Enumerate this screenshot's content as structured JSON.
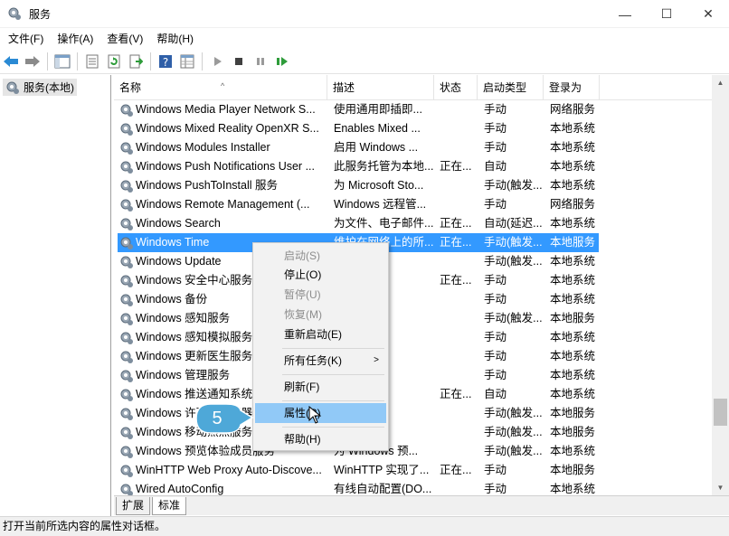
{
  "window": {
    "title": "服务",
    "minimize": "—",
    "maximize": "☐",
    "close": "✕"
  },
  "menu": [
    "文件(F)",
    "操作(A)",
    "查看(V)",
    "帮助(H)"
  ],
  "tree": {
    "root": "服务(本地)"
  },
  "columns": {
    "name": "名称",
    "desc": "描述",
    "status": "状态",
    "start": "启动类型",
    "logon": "登录为"
  },
  "rows": [
    {
      "name": "Windows Media Player Network S...",
      "desc": "使用通用即插即...",
      "status": "",
      "start": "手动",
      "logon": "网络服务"
    },
    {
      "name": "Windows Mixed Reality OpenXR S...",
      "desc": "Enables Mixed ...",
      "status": "",
      "start": "手动",
      "logon": "本地系统"
    },
    {
      "name": "Windows Modules Installer",
      "desc": "启用 Windows ...",
      "status": "",
      "start": "手动",
      "logon": "本地系统"
    },
    {
      "name": "Windows Push Notifications User ...",
      "desc": "此服务托管为本地...",
      "status": "正在...",
      "start": "自动",
      "logon": "本地系统"
    },
    {
      "name": "Windows PushToInstall 服务",
      "desc": "为 Microsoft Sto...",
      "status": "",
      "start": "手动(触发...",
      "logon": "本地系统"
    },
    {
      "name": "Windows Remote Management (...",
      "desc": "Windows 远程管...",
      "status": "",
      "start": "手动",
      "logon": "网络服务"
    },
    {
      "name": "Windows Search",
      "desc": "为文件、电子邮件...",
      "status": "正在...",
      "start": "自动(延迟...",
      "logon": "本地系统"
    },
    {
      "name": "Windows Time",
      "desc": "维护在网络上的所...",
      "status": "正在...",
      "start": "手动(触发...",
      "logon": "本地服务"
    },
    {
      "name": "Windows Update",
      "desc": "下载和...",
      "status": "",
      "start": "手动(触发...",
      "logon": "本地系统"
    },
    {
      "name": "Windows 安全中心服务",
      "desc": "安全中...",
      "status": "正在...",
      "start": "手动",
      "logon": "本地系统"
    },
    {
      "name": "Windows 备份",
      "desc": "ows ...",
      "status": "",
      "start": "手动",
      "logon": "本地系统"
    },
    {
      "name": "Windows 感知服务",
      "desc": "知、空...",
      "status": "",
      "start": "手动(触发...",
      "logon": "本地服务"
    },
    {
      "name": "Windows 感知模拟服务",
      "desc": "和模拟...",
      "status": "",
      "start": "手动",
      "logon": "本地系统"
    },
    {
      "name": "Windows 更新医生服务",
      "desc": "ows ...",
      "status": "",
      "start": "手动",
      "logon": "本地系统"
    },
    {
      "name": "Windows 管理服务",
      "desc": "配和注...",
      "status": "",
      "start": "手动",
      "logon": "本地系统"
    },
    {
      "name": "Windows 推送通知系统",
      "desc": "括 0 ...",
      "status": "正在...",
      "start": "自动",
      "logon": "本地系统"
    },
    {
      "name": "Windows 许可证管理器服务",
      "desc": "ft Sto...",
      "status": "",
      "start": "手动(触发...",
      "logon": "本地服务"
    },
    {
      "name": "Windows 移动热点服务",
      "desc": "备共共...",
      "status": "",
      "start": "手动(触发...",
      "logon": "本地服务"
    },
    {
      "name": "Windows 预览体验成员服务",
      "desc": "为 Windows 预...",
      "status": "",
      "start": "手动(触发...",
      "logon": "本地系统"
    },
    {
      "name": "WinHTTP Web Proxy Auto-Discove...",
      "desc": "WinHTTP 实现了...",
      "status": "正在...",
      "start": "手动",
      "logon": "本地服务"
    },
    {
      "name": "Wired AutoConfig",
      "desc": "有线自动配置(DO...",
      "status": "",
      "start": "手动",
      "logon": "本地系统"
    }
  ],
  "selected_row": 7,
  "context_menu": {
    "start": "启动(S)",
    "stop": "停止(O)",
    "pause": "暂停(U)",
    "resume": "恢复(M)",
    "restart": "重新启动(E)",
    "all_tasks": "所有任务(K)",
    "refresh": "刷新(F)",
    "properties": "属性(R)",
    "help": "帮助(H)"
  },
  "tabs": [
    "扩展",
    "标准"
  ],
  "status_text": "打开当前所选内容的属性对话框。",
  "callout": "5",
  "colors": {
    "selection": "#3399ff",
    "menu_highlight": "#91c9f7",
    "callout": "#4ea8d8"
  }
}
